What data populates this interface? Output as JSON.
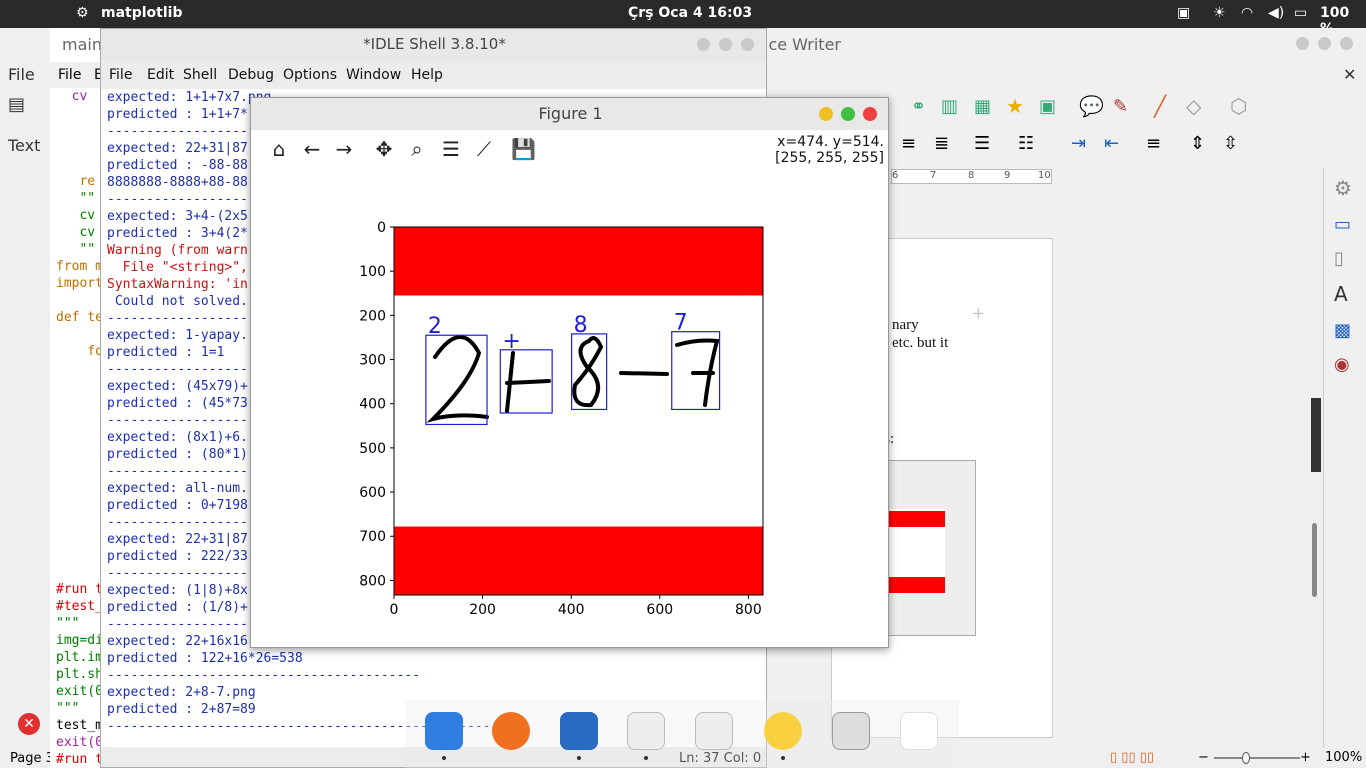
{
  "topbar": {
    "app_name": "matplotlib",
    "clock": "Çrş Oca 4  16:03",
    "battery": "100 %"
  },
  "writer": {
    "title": "ice Writer",
    "doc_text": [
      "nary",
      "etc. but it",
      "ges:"
    ],
    "ruler_marks": [
      "6",
      "7",
      "8",
      "9",
      "10"
    ],
    "zoom": "100%"
  },
  "left_app": {
    "file_label": "File",
    "text_label": "Text",
    "page_label": "Page 3"
  },
  "main_editor": {
    "title": "main.",
    "menu": [
      "File",
      "E"
    ],
    "code_lines": [
      {
        "t": "  cv",
        "c": "#a020a0"
      },
      {
        "t": "",
        "c": "#000"
      },
      {
        "t": "",
        "c": "#000"
      },
      {
        "t": "",
        "c": "#000"
      },
      {
        "t": "",
        "c": "#000"
      },
      {
        "t": "   re",
        "c": "#c07000"
      },
      {
        "t": "   \"\"",
        "c": "#008000"
      },
      {
        "t": "   cv",
        "c": "#008000"
      },
      {
        "t": "   cv",
        "c": "#008000"
      },
      {
        "t": "   \"\"",
        "c": "#008000"
      },
      {
        "t": "from m",
        "c": "#c07000"
      },
      {
        "t": "import",
        "c": "#c07000"
      },
      {
        "t": "",
        "c": "#000"
      },
      {
        "t": "def te",
        "c": "#c07000"
      },
      {
        "t": "",
        "c": "#000"
      },
      {
        "t": "    fo",
        "c": "#c07000"
      },
      {
        "t": "",
        "c": "#000"
      },
      {
        "t": "",
        "c": "#000"
      },
      {
        "t": "",
        "c": "#000"
      },
      {
        "t": "",
        "c": "#000"
      },
      {
        "t": "",
        "c": "#000"
      },
      {
        "t": "",
        "c": "#000"
      },
      {
        "t": "",
        "c": "#000"
      },
      {
        "t": "",
        "c": "#000"
      },
      {
        "t": "",
        "c": "#000"
      },
      {
        "t": "",
        "c": "#000"
      },
      {
        "t": "",
        "c": "#000"
      },
      {
        "t": "",
        "c": "#000"
      },
      {
        "t": "",
        "c": "#000"
      },
      {
        "t": "#run t",
        "c": "#dd0000"
      },
      {
        "t": "#test_",
        "c": "#dd0000"
      },
      {
        "t": "\"\"\"",
        "c": "#008000"
      },
      {
        "t": "img=di",
        "c": "#008000"
      },
      {
        "t": "plt.im",
        "c": "#008000"
      },
      {
        "t": "plt.sh",
        "c": "#008000"
      },
      {
        "t": "exit(0",
        "c": "#008000"
      },
      {
        "t": "\"\"\"",
        "c": "#008000"
      },
      {
        "t": "test_m",
        "c": "#000000"
      },
      {
        "t": "exit(0",
        "c": "#a020a0"
      },
      {
        "t": "#run t",
        "c": "#dd0000"
      }
    ]
  },
  "idle": {
    "title": "*IDLE Shell 3.8.10*",
    "menu": [
      "File",
      "Edit",
      "Shell",
      "Debug",
      "Options",
      "Window",
      "Help"
    ],
    "lines": [
      {
        "t": "expected: 1+1+7x7.png",
        "c": "#1d2fb0"
      },
      {
        "t": "predicted : 1+1+7*",
        "c": "#1d2fb0"
      },
      {
        "t": "----------------------------------------",
        "c": "#1d2fb0"
      },
      {
        "t": "expected: 22+31|87",
        "c": "#1d2fb0"
      },
      {
        "t": "predicted : -88-88",
        "c": "#1d2fb0"
      },
      {
        "t": "8888888-8888+88-88",
        "c": "#1d2fb0"
      },
      {
        "t": "----------------------------------------",
        "c": "#1d2fb0"
      },
      {
        "t": "expected: 3+4-(2x5",
        "c": "#1d2fb0"
      },
      {
        "t": "predicted : 3+4(2*",
        "c": "#1d2fb0"
      },
      {
        "t": "Warning (from warn",
        "c": "#d01010"
      },
      {
        "t": "  File \"<string>\",",
        "c": "#d01010"
      },
      {
        "t": "SyntaxWarning: 'in",
        "c": "#d01010"
      },
      {
        "t": " Could not solved.",
        "c": "#1d2fb0"
      },
      {
        "t": "----------------------------------------",
        "c": "#1d2fb0"
      },
      {
        "t": "expected: 1-yapay.",
        "c": "#1d2fb0"
      },
      {
        "t": "predicted : 1=1",
        "c": "#1d2fb0"
      },
      {
        "t": "----------------------------------------",
        "c": "#1d2fb0"
      },
      {
        "t": "expected: (45x79)+",
        "c": "#1d2fb0"
      },
      {
        "t": "predicted : (45*73",
        "c": "#1d2fb0"
      },
      {
        "t": "----------------------------------------",
        "c": "#1d2fb0"
      },
      {
        "t": "expected: (8x1)+6.",
        "c": "#1d2fb0"
      },
      {
        "t": "predicted : (80*1)",
        "c": "#1d2fb0"
      },
      {
        "t": "----------------------------------------",
        "c": "#1d2fb0"
      },
      {
        "t": "expected: all-num.",
        "c": "#1d2fb0"
      },
      {
        "t": "predicted : 0+7198",
        "c": "#1d2fb0"
      },
      {
        "t": "----------------------------------------",
        "c": "#1d2fb0"
      },
      {
        "t": "expected: 22+31|87",
        "c": "#1d2fb0"
      },
      {
        "t": "predicted : 222/33",
        "c": "#1d2fb0"
      },
      {
        "t": "----------------------------------------",
        "c": "#1d2fb0"
      },
      {
        "t": "expected: (1|8)+8x",
        "c": "#1d2fb0"
      },
      {
        "t": "predicted : (1/8)+",
        "c": "#1d2fb0"
      },
      {
        "t": "----------------------------------------",
        "c": "#1d2fb0"
      },
      {
        "t": "expected: 22+16x16",
        "c": "#1d2fb0"
      },
      {
        "t": "predicted : 122+16*26=538",
        "c": "#1d2fb0"
      },
      {
        "t": "----------------------------------------",
        "c": "#1d2fb0"
      },
      {
        "t": "expected: 2+8-7.png",
        "c": "#1d2fb0"
      },
      {
        "t": "predicted : 2+87=89",
        "c": "#1d2fb0"
      },
      {
        "t": "----------------------------------------------------",
        "c": "#1d2fb0"
      }
    ],
    "status": "Ln: 37  Col: 0"
  },
  "figure": {
    "title": "Figure 1",
    "coords_line1": "x=474. y=514.",
    "coords_line2": "[255, 255, 255]",
    "tools": [
      "home-icon",
      "back-icon",
      "forward-icon",
      "pan-icon",
      "zoom-icon",
      "configure-icon",
      "edit-axis-icon",
      "save-icon"
    ]
  },
  "chart_data": {
    "type": "image",
    "xlim": [
      0,
      833
    ],
    "ylim": [
      833,
      0
    ],
    "x_ticks": [
      0,
      200,
      400,
      600,
      800
    ],
    "y_ticks": [
      0,
      100,
      200,
      300,
      400,
      500,
      600,
      700,
      800
    ],
    "red_bands": [
      {
        "y0": 0,
        "y1": 155
      },
      {
        "y0": 678,
        "y1": 833
      }
    ],
    "band_color": "#ff0000",
    "box_color": "#1f1fd0",
    "boxes": [
      {
        "label": "2",
        "x0": 72,
        "y0": 245,
        "x1": 210,
        "y1": 447
      },
      {
        "label": "+",
        "x0": 240,
        "y0": 278,
        "x1": 357,
        "y1": 421
      },
      {
        "label": "8",
        "x0": 401,
        "y0": 242,
        "x1": 480,
        "y1": 413
      },
      {
        "label": "7",
        "x0": 627,
        "y0": 237,
        "x1": 735,
        "y1": 413
      }
    ]
  },
  "dock": {
    "icons": [
      "finder-icon",
      "firefox-icon",
      "writer-icon",
      "python-file-icon",
      "python-file-icon",
      "pinwheel-icon",
      "trash-icon",
      "apps-grid-icon"
    ]
  }
}
